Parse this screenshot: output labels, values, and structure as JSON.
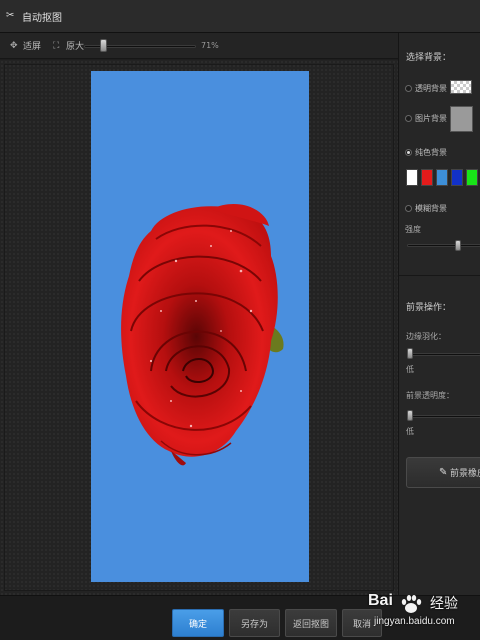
{
  "window": {
    "title": "自动抠图",
    "app_icon": "scissors-icon"
  },
  "toolbar": {
    "fit_label": "适屏",
    "fit_icon": "fit-screen-icon",
    "actual_label": "原大",
    "actual_icon": "actual-size-icon",
    "zoom_value": "71%",
    "zoom_percent": 71
  },
  "canvas": {
    "background_color": "#4a8fde",
    "subject": "red-rose"
  },
  "right_panel": {
    "choose_bg_heading": "选择背景：",
    "options": [
      {
        "label": "透明背景",
        "selected": false
      },
      {
        "label": "图片背景",
        "selected": false
      },
      {
        "label": "纯色背景",
        "selected": true
      },
      {
        "label": "模糊背景",
        "selected": false
      }
    ],
    "colors": [
      "#ffffff",
      "#e41b1b",
      "#3d8fd8",
      "#1231c8",
      "#18e418"
    ],
    "strength_label": "强度",
    "strength_value": 0.72,
    "fg_ops_heading": "前景操作：",
    "feather_label": "边缘羽化：",
    "feather_min_label": "低",
    "feather_value": 0.0,
    "fg_opacity_label": "前景透明度：",
    "fg_opacity_min_label": "低",
    "fg_opacity_value": 0.0,
    "bg_erase_label": "前景橡皮擦",
    "bg_erase_icon": "eraser-icon"
  },
  "bottom": {
    "confirm_label": "确定",
    "save_as_label": "另存为",
    "back_label": "返回抠图",
    "cancel_label": "取消"
  },
  "watermark": {
    "brand": "Bai",
    "brand_suffix": "经验",
    "url": "jingyan.baidu.com",
    "paw_icon": "baidu-paw-icon"
  }
}
